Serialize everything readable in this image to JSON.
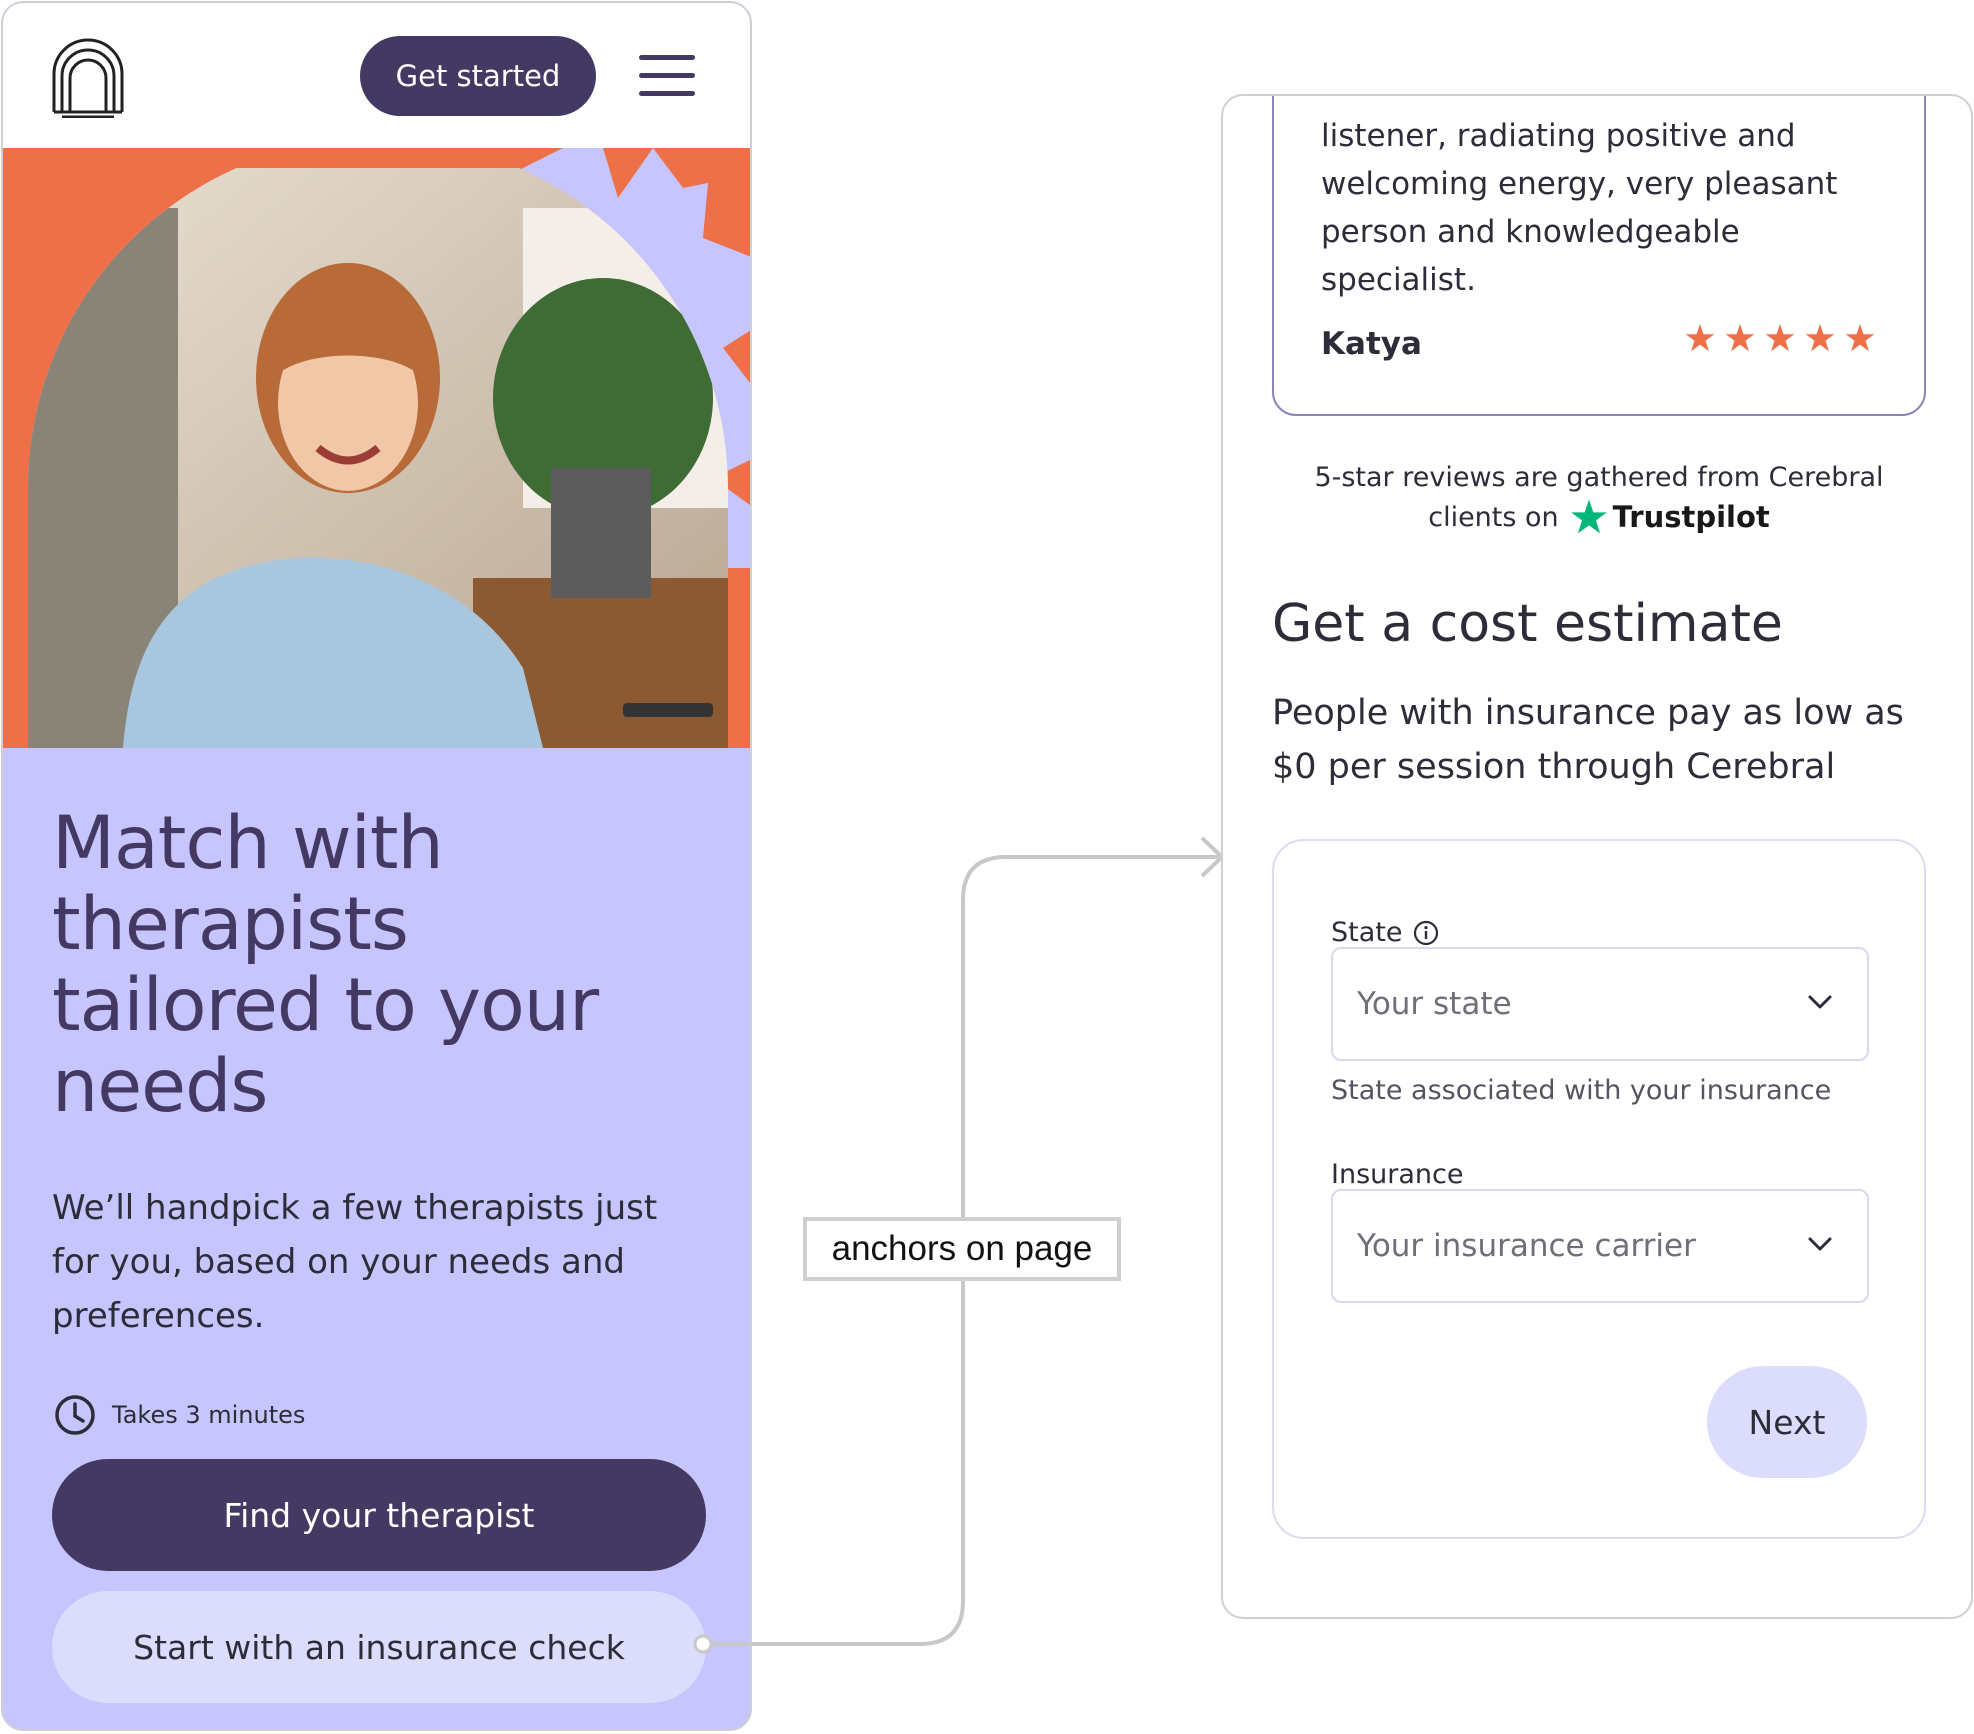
{
  "header": {
    "logo_icon": "arch-logo-icon",
    "get_started_label": "Get started",
    "menu_icon": "hamburger-menu-icon"
  },
  "hero": {
    "image": "smiling-woman-photo",
    "headline": "Match with therapists tailored to your needs",
    "subcopy": "We’ll handpick a few therapists just for you, based on your needs and preferences.",
    "duration_icon": "clock-icon",
    "duration": "Takes 3 minutes",
    "primary_cta": "Find your therapist",
    "secondary_cta": "Start with an insurance check"
  },
  "annotation": {
    "label": "anchors on page"
  },
  "review": {
    "text": "listener, radiating positive and welcoming energy, very pleasant person and knowledgeable specialist.",
    "author": "Katya",
    "rating": 5,
    "star_color": "#ee7049"
  },
  "trustpilot": {
    "line1": "5-star reviews are gathered from Cerebral",
    "line2_prefix": "clients on",
    "brand": "Trustpilot",
    "brand_color": "#00b67a"
  },
  "cost_estimate": {
    "title": "Get a cost estimate",
    "subtitle": "People with insurance pay as low as $0 per session through Cerebral",
    "state_label": "State",
    "state_placeholder": "Your state",
    "state_helper": "State associated with your insurance",
    "insurance_label": "Insurance",
    "insurance_placeholder": "Your insurance carrier",
    "next_label": "Next"
  },
  "colors": {
    "brand_dark": "#433963",
    "lavender": "#c6c5fd",
    "light_lavender": "#dcdcfd",
    "coral": "#ee7049"
  }
}
